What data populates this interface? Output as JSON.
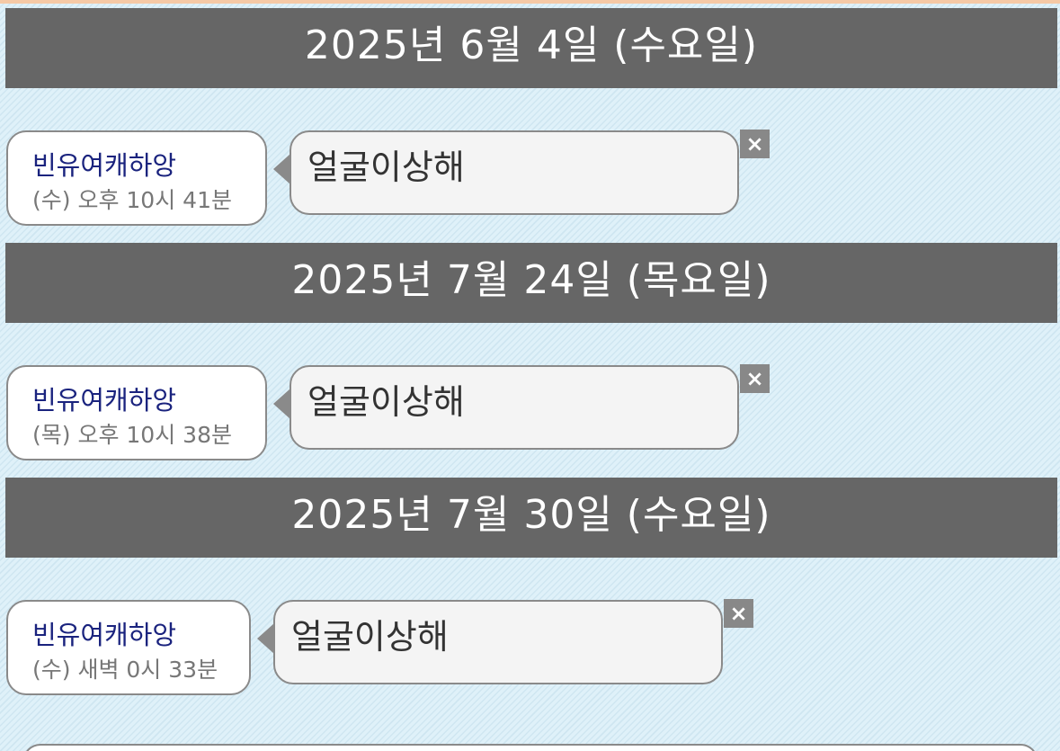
{
  "colors": {
    "background": "#dcf0f8",
    "header_bg": "#666666",
    "name_color": "#1a237e",
    "time_color": "#777777",
    "bubble_bg": "#f4f4f4",
    "border": "#8a8a8a",
    "delete_bg": "#888888"
  },
  "groups": [
    {
      "date": "2025년 6월 4일 (수요일)",
      "message": {
        "sender": "빈유여캐하앙",
        "time": "(수) 오후 10시 41분",
        "text": "얼굴이상해",
        "delete_icon": "close-icon",
        "delete_label": "×"
      }
    },
    {
      "date": "2025년 7월 24일 (목요일)",
      "message": {
        "sender": "빈유여캐하앙",
        "time": "(목) 오후 10시 38분",
        "text": "얼굴이상해",
        "delete_icon": "close-icon",
        "delete_label": "×"
      }
    },
    {
      "date": "2025년 7월 30일 (수요일)",
      "message": {
        "sender": "빈유여캐하앙",
        "time": "(수) 새벽 0시 33분",
        "text": "얼굴이상해",
        "delete_icon": "close-icon",
        "delete_label": "×"
      }
    }
  ]
}
